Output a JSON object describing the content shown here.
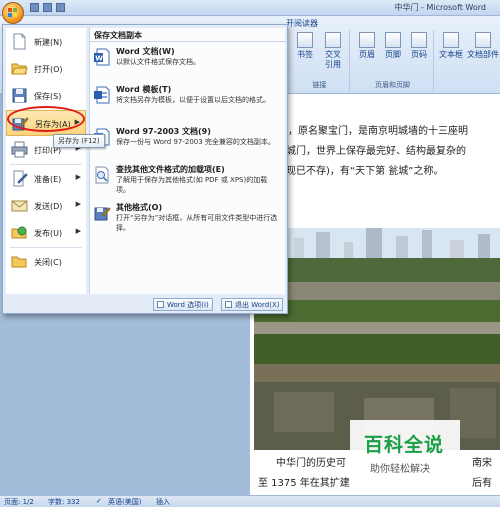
{
  "window": {
    "title": "中华门 - Microsoft Word"
  },
  "ribbon": {
    "tab_ref": "开阅读器",
    "groups": [
      {
        "label": "",
        "items": [
          {
            "label": "书签",
            "icon": "bookmark-icon"
          },
          {
            "label": "交叉\n引用",
            "icon": "cross-reference-icon"
          }
        ]
      },
      {
        "label": "页眉和页脚",
        "items": [
          {
            "label": "页眉",
            "icon": "header-icon"
          },
          {
            "label": "页脚",
            "icon": "footer-icon"
          },
          {
            "label": "页码",
            "icon": "page-number-icon"
          }
        ]
      },
      {
        "label": "",
        "items": [
          {
            "label": "文本框",
            "icon": "textbox-icon"
          },
          {
            "label": "文档部件",
            "icon": "document-parts-icon"
          }
        ]
      }
    ],
    "group_links_label": "链接"
  },
  "office_menu": {
    "left_items": [
      {
        "label": "新建(N)",
        "icon": "new-document-icon",
        "has_submenu": false
      },
      {
        "label": "打开(O)",
        "icon": "open-folder-icon",
        "has_submenu": false
      },
      {
        "label": "保存(S)",
        "icon": "save-icon",
        "has_submenu": false
      },
      {
        "label": "另存为(A)",
        "icon": "save-as-icon",
        "has_submenu": true
      },
      {
        "label": "打印(P)",
        "icon": "print-icon",
        "has_submenu": true
      },
      {
        "label": "准备(E)",
        "icon": "prepare-icon",
        "has_submenu": true
      },
      {
        "label": "发送(D)",
        "icon": "send-icon",
        "has_submenu": true
      },
      {
        "label": "发布(U)",
        "icon": "publish-icon",
        "has_submenu": true
      },
      {
        "label": "关闭(C)",
        "icon": "close-document-icon",
        "has_submenu": false
      }
    ],
    "active_index": 3,
    "right_heading": "保存文档副本",
    "save_options": [
      {
        "title": "Word 文档(W)",
        "desc": "以默认文件格式保存文档。",
        "icon": "word-document-icon"
      },
      {
        "title": "Word 模板(T)",
        "desc": "将文档另存为模板，以便于设置以后文档的格式。",
        "icon": "word-template-icon"
      },
      {
        "title": "Word 97-2003 文档(9)",
        "desc": "保存一份与 Word 97-2003 完全兼容的文档副本。",
        "icon": "word-97-2003-icon"
      },
      {
        "title": "查找其他文件格式的加载项(E)",
        "desc": "了解用于保存为其他格式(如 PDF 或 XPS)的加载项。",
        "icon": "addins-search-icon"
      },
      {
        "title": "其他格式(O)",
        "desc": "打开“另存为”对话框，从所有可用文件类型中进行选择。",
        "icon": "other-formats-icon"
      }
    ],
    "word_options_label": "Word 选项(I)",
    "exit_word_label": "退出 Word(X)"
  },
  "tooltip": "另存为 (F12)",
  "document": {
    "lines_top": [
      "华门，原名聚宝门，是南京明城墙的十三座明",
      "大的城门，世界上保存最完好、结构最复杂的",
      "门（现已不存)，有“天下第  瓮城”之称。"
    ],
    "lines_bottom": [
      "中华门的历史可",
      "至 1375 年在其扩建"
    ],
    "bottom_right_fragments": [
      "南宋",
      "后有"
    ]
  },
  "watermark": {
    "title": "百科全说",
    "subtitle": "助你轻松解决"
  },
  "status": {
    "page": "页面: 1/2",
    "words": "字数: 332",
    "language": "英语(美国)",
    "mode": "插入"
  },
  "colors": {
    "highlight_oval": "#e11d18",
    "active_item": "#fbd47a",
    "watermark_green": "#1a9e46"
  }
}
